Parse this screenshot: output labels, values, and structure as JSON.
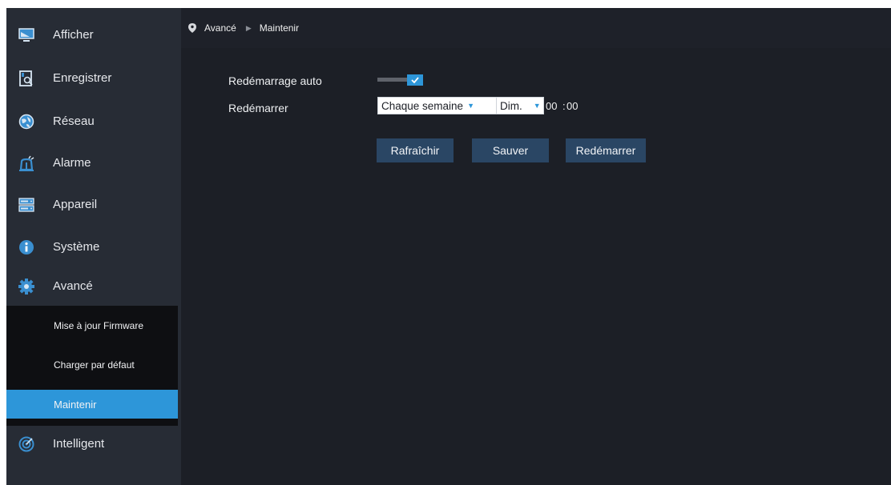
{
  "sidebar": {
    "items": [
      {
        "label": "Afficher",
        "icon": "monitor-icon"
      },
      {
        "label": "Enregistrer",
        "icon": "record-search-icon"
      },
      {
        "label": "Réseau",
        "icon": "globe-icon"
      },
      {
        "label": "Alarme",
        "icon": "alarm-bell-icon"
      },
      {
        "label": "Appareil",
        "icon": "hard-disk-icon"
      },
      {
        "label": "Système",
        "icon": "info-icon"
      },
      {
        "label": "Avancé",
        "icon": "gear-icon"
      },
      {
        "label": "Intelligent",
        "icon": "target-icon"
      }
    ],
    "subitems": [
      {
        "label": "Mise à jour Firmware"
      },
      {
        "label": "Charger par défaut"
      },
      {
        "label": "Maintenir",
        "active": true
      }
    ]
  },
  "breadcrumb": {
    "section": "Avancé",
    "page": "Maintenir"
  },
  "form": {
    "auto_restart_label": "Redémarrage auto",
    "auto_restart_enabled": true,
    "restart_label": "Redémarrer",
    "frequency": "Chaque semaine",
    "day": "Dim.",
    "hour": "00",
    "time_sep": ":",
    "minute": "00"
  },
  "buttons": {
    "refresh": "Rafraîchir",
    "save": "Sauver",
    "restart": "Redémarrer"
  },
  "colors": {
    "accent": "#2d96d9",
    "button": "#2a4664",
    "sidebar": "#272c35",
    "content": "#1c1f26"
  }
}
